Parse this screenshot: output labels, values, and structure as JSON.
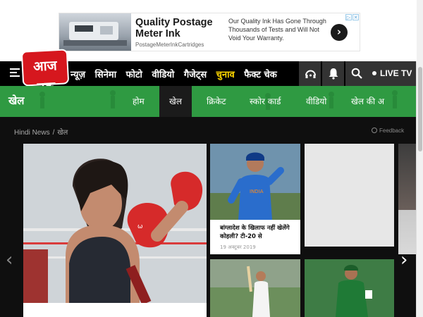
{
  "ad": {
    "title": "Quality Postage Meter Ink",
    "url": "PostageMeterInkCartridges",
    "description": "Our Quality Ink Has Gone Through Thousands of Tests and Will Not Void Your Warranty.",
    "arrow_icon": "chevron-right-icon",
    "choices_icons": [
      "adchoices-icon",
      "close-icon"
    ]
  },
  "header": {
    "logo_text": "आज तक",
    "nav_links": [
      "न्यूज़",
      "सिनेमा",
      "फोटो",
      "वीडियो",
      "गैजेट्स",
      "चुनाव",
      "फैक्ट चेक"
    ],
    "highlight_index": 5,
    "live_label": "LIVE TV",
    "icons": [
      "menu-icon",
      "audio-icon",
      "bell-icon",
      "search-icon"
    ]
  },
  "section": {
    "title": "खेल",
    "tabs": [
      "होम",
      "खेल",
      "क्रिकेट",
      "स्कोर कार्ड",
      "वीडियो",
      "खेल की अ"
    ],
    "active_tab": "खेल",
    "accent_color": "#2f9a42"
  },
  "breadcrumb": {
    "home": "Hindi News",
    "separator": "/",
    "current": "खेल"
  },
  "feedback_label": "Feedback",
  "cards": {
    "main": {
      "caption": ""
    },
    "kohli": {
      "title": "बांग्लादेश के खिलाफ नहीं खेलेंगे कोहली? टी-20 से",
      "date": "19 अक्टूबर 2019"
    }
  },
  "carousel": {
    "prev_icon": "chevron-left-icon",
    "next_icon": "chevron-right-icon"
  }
}
